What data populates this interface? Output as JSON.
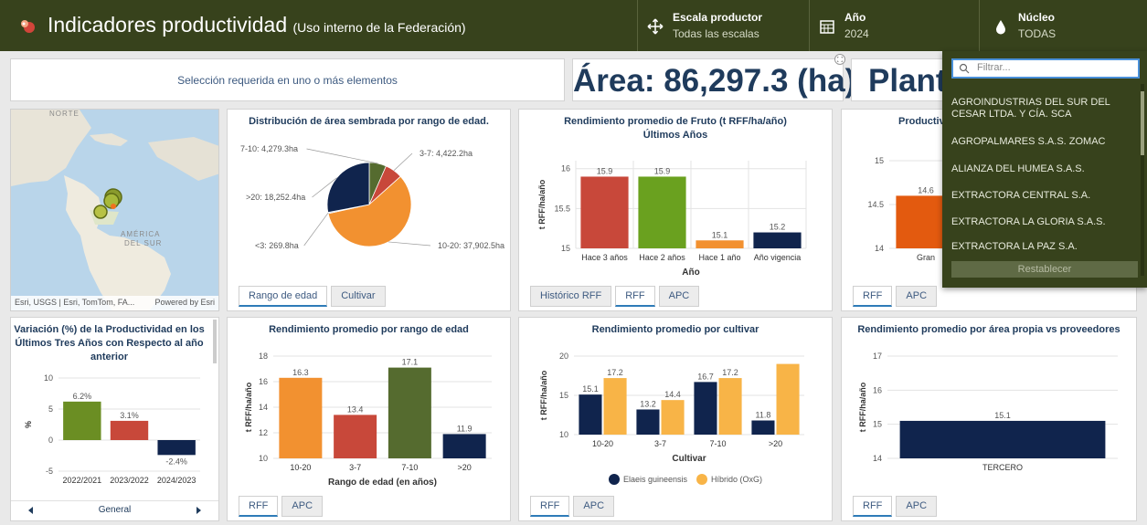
{
  "header": {
    "title": "Indicadores productividad",
    "subtitle": "(Uso interno de la Federación)",
    "filters": [
      {
        "label": "Escala productor",
        "value": "Todas las escalas",
        "icon": "move-arrows-icon"
      },
      {
        "label": "Año",
        "value": "2024",
        "icon": "calendar-icon"
      },
      {
        "label": "Núcleo",
        "value": "TODAS",
        "icon": "drop-icon"
      }
    ]
  },
  "selection_message": "Selección requerida en uno o más elementos",
  "area_indicator": "Área: 86,297.3 (ha)",
  "plant_indicator": "Plant",
  "map": {
    "label_north": "NORTE",
    "label_south_1": "AMÉRICA",
    "label_south_2": "DEL SUR",
    "attribution": "Esri, USGS | Esri, TomTom, FA...",
    "powered": "Powered by Esri"
  },
  "dropdown": {
    "placeholder": "Filtrar...",
    "items": [
      "AGROINDUSTRIAS DEL SUR DEL CESAR LTDA. Y CÍA. SCA",
      "AGROPALMARES S.A.S. ZOMAC",
      "ALIANZA DEL HUMEA S.A.S.",
      "EXTRACTORA CENTRAL S.A.",
      "EXTRACTORA LA GLORIA S.A.S.",
      "EXTRACTORA LA PAZ S.A."
    ],
    "reset_label": "Restablecer"
  },
  "panels": {
    "pie": {
      "title": "Distribución de área sembrada por rango de edad.",
      "tabs": [
        "Rango de edad",
        "Cultivar"
      ]
    },
    "fruto": {
      "title_1": "Rendimiento promedio de Fruto (t RFF/ha/año)",
      "title_2": "Últimos Años",
      "tabs": [
        "Histórico RFF",
        "RFF",
        "APC"
      ]
    },
    "escala": {
      "title": "Productividad",
      "tabs": [
        "RFF",
        "APC"
      ]
    },
    "variacion": {
      "title_1": "Variación (%) de la Productividad en los",
      "title_2": "Últimos Tres Años con Respecto al año",
      "title_3": "anterior",
      "nav_label": "General"
    },
    "edad": {
      "title": "Rendimiento promedio por rango de edad",
      "tabs": [
        "RFF",
        "APC"
      ]
    },
    "cultivar": {
      "title": "Rendimiento promedio por cultivar",
      "tabs": [
        "RFF",
        "APC"
      ]
    },
    "propia": {
      "title": "Rendimiento promedio por área propia vs proveedores",
      "tabs": [
        "RFF",
        "APC"
      ]
    }
  },
  "chart_data": [
    {
      "type": "pie",
      "title": "Distribución de área sembrada por rango de edad.",
      "categories": [
        "7-10",
        "3-7",
        "10-20",
        "<3",
        ">20"
      ],
      "values": [
        4279.3,
        4422.2,
        37902.5,
        269.8,
        18252.4
      ],
      "labels": [
        "7-10: 4,279.3ha",
        "3-7: 4,422.2ha",
        "10-20: 37,902.5ha",
        "<3: 269.8ha",
        ">20: 18,252.4ha"
      ],
      "colors": [
        "#556b2f",
        "#c8483a",
        "#f29130",
        "#7aa1c8",
        "#10244d"
      ]
    },
    {
      "type": "bar",
      "title": "Rendimiento promedio de Fruto (t RFF/ha/año) Últimos Años",
      "categories": [
        "Hace 3 años",
        "Hace 2 años",
        "Hace 1 año",
        "Año vigencia"
      ],
      "values": [
        15.9,
        15.9,
        15.1,
        15.2
      ],
      "colors": [
        "#c8483a",
        "#6aa11f",
        "#f29130",
        "#10244d"
      ],
      "xlabel": "Año",
      "ylabel": "t RFF/ha/año",
      "yticks": [
        15,
        15.5,
        16
      ],
      "ylim": [
        15,
        16.1
      ]
    },
    {
      "type": "bar",
      "title": "Productividad",
      "categories": [
        "Gran"
      ],
      "values": [
        14.6
      ],
      "colors": [
        "#e35a0f"
      ],
      "yticks": [
        14,
        14.5,
        15
      ],
      "ylim": [
        14,
        15
      ]
    },
    {
      "type": "bar",
      "title": "Variación (%) de la Productividad en los Últimos Tres Años con Respecto al año anterior",
      "categories": [
        "2022/2021",
        "2023/2022",
        "2024/2023"
      ],
      "values": [
        6.2,
        3.1,
        -2.4
      ],
      "labels": [
        "6.2%",
        "3.1%",
        "-2.4%"
      ],
      "colors": [
        "#6b8e23",
        "#c8483a",
        "#10244d"
      ],
      "ylabel": "%",
      "yticks": [
        -5,
        0,
        5,
        10
      ],
      "ylim": [
        -5,
        10
      ]
    },
    {
      "type": "bar",
      "title": "Rendimiento promedio por rango de edad",
      "categories": [
        "10-20",
        "3-7",
        "7-10",
        ">20"
      ],
      "values": [
        16.3,
        13.4,
        17.1,
        11.9
      ],
      "colors": [
        "#f29130",
        "#c8483a",
        "#556b2f",
        "#10244d"
      ],
      "xlabel": "Rango de edad (en años)",
      "ylabel": "t RFF/ha/año",
      "yticks": [
        10,
        12,
        14,
        16,
        18
      ],
      "ylim": [
        10,
        18
      ]
    },
    {
      "type": "bar",
      "title": "Rendimiento promedio por cultivar",
      "categories": [
        "10-20",
        "3-7",
        "7-10",
        ">20"
      ],
      "series": [
        {
          "name": "Elaeis guineensis",
          "values": [
            15.1,
            13.2,
            16.7,
            11.8
          ],
          "color": "#10244d"
        },
        {
          "name": "Híbrido (OxG)",
          "values": [
            17.2,
            14.4,
            17.2,
            19.0
          ],
          "color": "#f8b447"
        }
      ],
      "xlabel": "Cultivar",
      "ylabel": "t RFF/ha/año",
      "yticks": [
        10,
        15,
        20
      ],
      "ylim": [
        10,
        20
      ]
    },
    {
      "type": "bar",
      "title": "Rendimiento promedio por área propia vs proveedores",
      "categories": [
        "TERCERO"
      ],
      "values": [
        15.1
      ],
      "colors": [
        "#10244d"
      ],
      "ylabel": "t RFF/ha/año",
      "yticks": [
        14,
        15,
        16,
        17
      ],
      "ylim": [
        14,
        17
      ]
    }
  ]
}
